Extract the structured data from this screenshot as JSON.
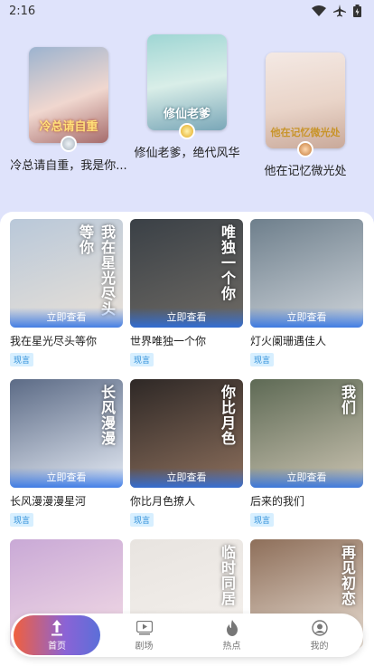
{
  "status_bar": {
    "time": "2:16"
  },
  "top3": [
    {
      "title": "冷总请自重，我是你...",
      "cover_text": "冷总请自重",
      "medal": "silver"
    },
    {
      "title": "修仙老爹，绝代风华",
      "cover_text": "修仙老爹",
      "medal": "gold"
    },
    {
      "title": "他在记忆微光处",
      "cover_text": "他在记忆微光处",
      "medal": "bronze"
    }
  ],
  "grid": {
    "watch_label": "立即查看",
    "items": [
      {
        "title": "我在星光尽头等你",
        "tag": "现言",
        "poster": "我在星光尽头等你",
        "colors": [
          "#b9c8d9",
          "#e9e1d8"
        ]
      },
      {
        "title": "世界唯独一个你",
        "tag": "现言",
        "poster": "唯独一个你",
        "colors": [
          "#3a4046",
          "#6e6a64"
        ]
      },
      {
        "title": "灯火阑珊遇佳人",
        "tag": "现言",
        "poster": "",
        "colors": [
          "#6e7f8c",
          "#cdd3d9"
        ]
      },
      {
        "title": "长风漫漫漫星河",
        "tag": "现言",
        "poster": "长风漫漫",
        "colors": [
          "#5c6b86",
          "#e4eaf4"
        ]
      },
      {
        "title": "你比月色撩人",
        "tag": "现言",
        "poster": "你比月色",
        "colors": [
          "#2e2826",
          "#8c6f5c"
        ]
      },
      {
        "title": "后来的我们",
        "tag": "现言",
        "poster": "我们",
        "colors": [
          "#5e6a55",
          "#c9c2b0"
        ]
      },
      {
        "title": "",
        "tag": "",
        "poster": "",
        "colors": [
          "#c9a9d6",
          "#f4dde6"
        ]
      },
      {
        "title": "",
        "tag": "",
        "poster": "临时同居",
        "colors": [
          "#e8e4e0",
          "#f5f1ed"
        ]
      },
      {
        "title": "",
        "tag": "",
        "poster": "再见初恋",
        "colors": [
          "#8e6f5a",
          "#e8ddd2"
        ]
      }
    ]
  },
  "tabbar": {
    "tabs": [
      {
        "label": "首页",
        "icon": "home-upload-icon"
      },
      {
        "label": "剧场",
        "icon": "play-icon"
      },
      {
        "label": "热点",
        "icon": "flame-icon"
      },
      {
        "label": "我的",
        "icon": "user-icon"
      }
    ],
    "accent": "#f0603e"
  }
}
